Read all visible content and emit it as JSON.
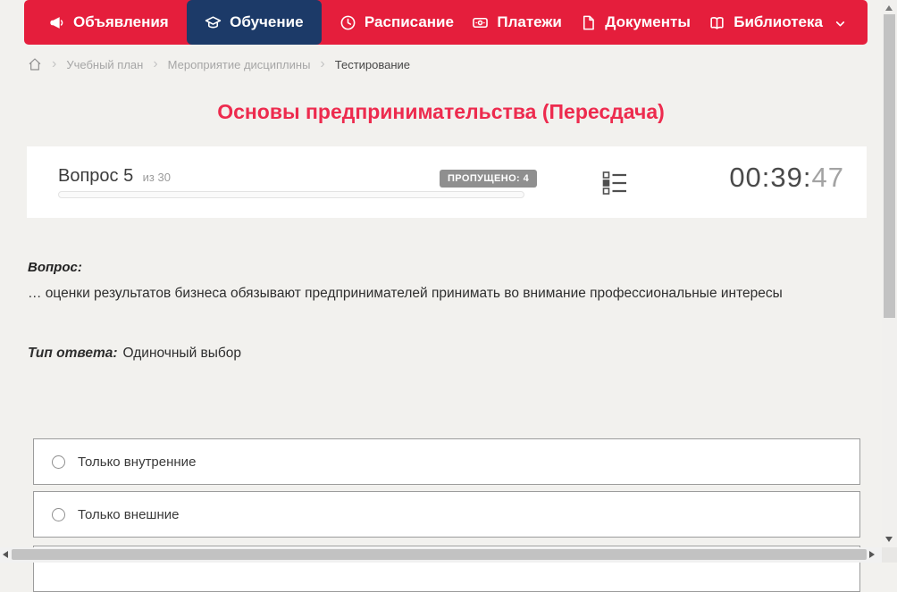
{
  "nav": {
    "items": [
      {
        "label": "Объявления",
        "icon": "megaphone-icon",
        "active": false
      },
      {
        "label": "Обучение",
        "icon": "graduation-cap-icon",
        "active": true
      },
      {
        "label": "Расписание",
        "icon": "clock-icon",
        "active": false
      },
      {
        "label": "Платежи",
        "icon": "banknote-icon",
        "active": false
      },
      {
        "label": "Документы",
        "icon": "document-icon",
        "active": false
      },
      {
        "label": "Библиотека",
        "icon": "open-book-icon",
        "active": false,
        "dropdown_icon": "chevron-down-icon"
      }
    ]
  },
  "breadcrumb": {
    "home_icon": "home-icon",
    "items": [
      "Учебный план",
      "Мероприятие дисциплины",
      "Тестирование"
    ],
    "separator": "›"
  },
  "page": {
    "title": "Основы предпринимательства (Пересдача)"
  },
  "quiz": {
    "question_label": "Вопрос 5",
    "question_of": "из 30",
    "skipped_badge": "ПРОПУЩЕНО: 4",
    "question_list_icon": "list-outline-icon",
    "timer": {
      "hhmm": "00:39:",
      "seconds": "47"
    },
    "progress_percent": 0,
    "question_heading": "Вопрос:",
    "question_text": "… оценки результатов бизнеса обязывают предпринимателей принимать во внимание профессиональные интересы",
    "answer_type_label": "Тип ответа:",
    "answer_type": "Одиночный выбор",
    "options": [
      {
        "label": "Только внутренние",
        "selected": false
      },
      {
        "label": "Только внешние",
        "selected": false
      }
    ]
  },
  "colors": {
    "brand_red": "#e51e3c",
    "title_red": "#ed2b4e",
    "active_tab_navy": "#1c3a68",
    "badge_gray": "#8f8f8f"
  }
}
